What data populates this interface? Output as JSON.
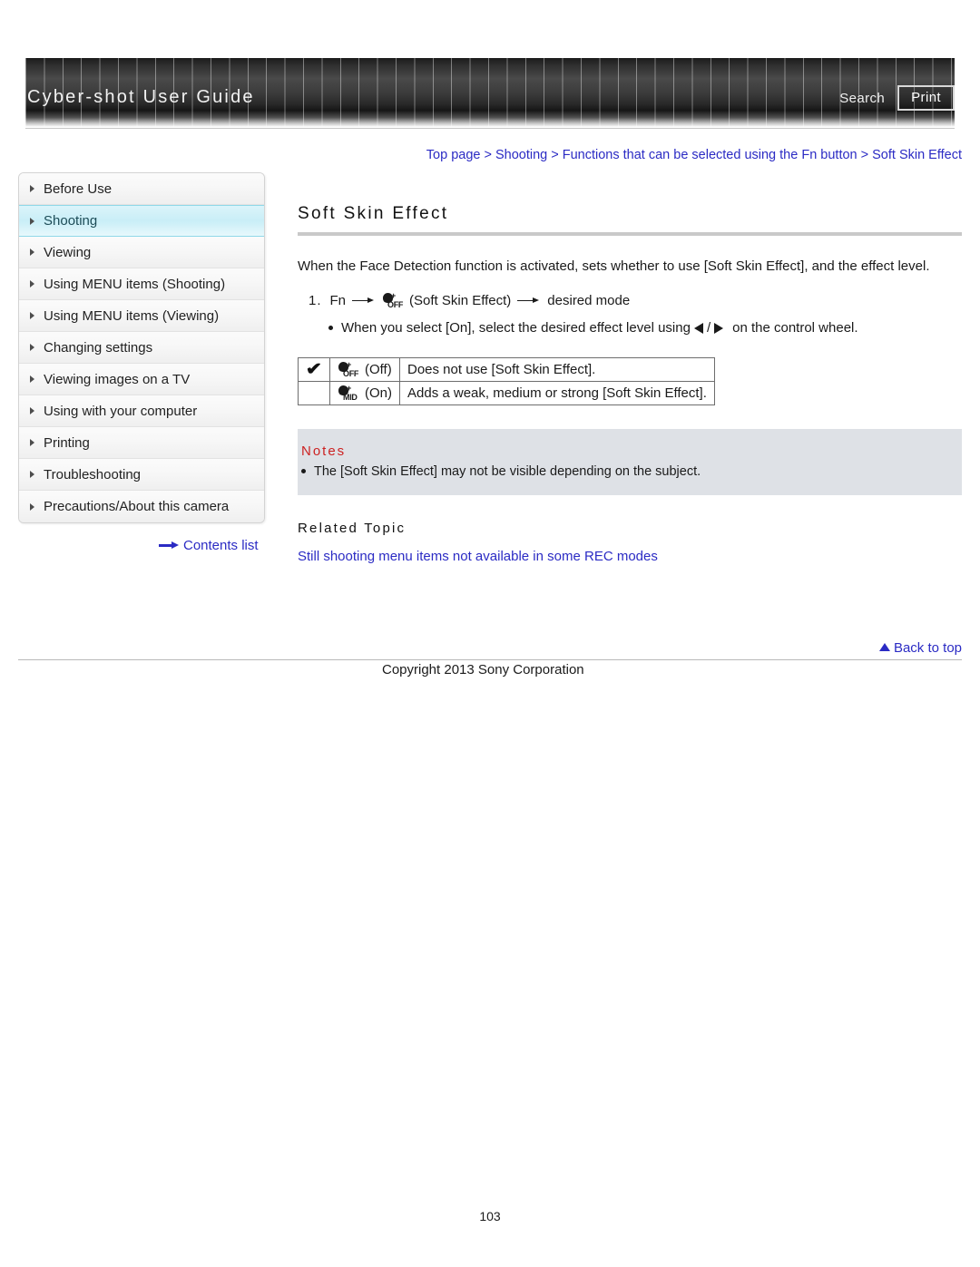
{
  "header": {
    "title": "Cyber-shot User Guide",
    "search_label": "Search",
    "print_label": "Print"
  },
  "breadcrumb": {
    "text": "Top page > Shooting > Functions that can be selected using the Fn button > Soft Skin Effect"
  },
  "sidebar": {
    "items": [
      {
        "label": "Before Use",
        "active": false
      },
      {
        "label": "Shooting",
        "active": true
      },
      {
        "label": "Viewing",
        "active": false
      },
      {
        "label": "Using MENU items (Shooting)",
        "active": false
      },
      {
        "label": "Using MENU items (Viewing)",
        "active": false
      },
      {
        "label": "Changing settings",
        "active": false
      },
      {
        "label": "Viewing images on a TV",
        "active": false
      },
      {
        "label": "Using with your computer",
        "active": false
      },
      {
        "label": "Printing",
        "active": false
      },
      {
        "label": "Troubleshooting",
        "active": false
      },
      {
        "label": "Precautions/About this camera",
        "active": false
      }
    ],
    "contents_list_label": "Contents list"
  },
  "main": {
    "title": "Soft Skin Effect",
    "intro": "When the Face Detection function is activated, sets whether to use [Soft Skin Effect], and the effect level.",
    "step_number": "1.",
    "step_fn": "Fn",
    "step_icon_label": "OFF",
    "step_icon_caption": "(Soft Skin Effect)",
    "step_tail": "desired mode",
    "bullet_before": "When you select [On], select the desired effect level using",
    "bullet_separator": "/",
    "bullet_after": "on the control wheel.",
    "table": {
      "rows": [
        {
          "checked": "✔",
          "icon_label": "OFF",
          "mode_label": "(Off)",
          "description": "Does not use [Soft Skin Effect]."
        },
        {
          "checked": "",
          "icon_label": "MID",
          "mode_label": "(On)",
          "description": "Adds a weak, medium or strong [Soft Skin Effect]."
        }
      ]
    },
    "notes_title": "Notes",
    "notes_items": [
      "The [Soft Skin Effect] may not be visible depending on the subject."
    ],
    "related_title": "Related Topic",
    "related_link": "Still shooting menu items not available in some REC modes"
  },
  "footer": {
    "back_to_top": "Back to top",
    "copyright": "Copyright 2013 Sony Corporation",
    "page_number": "103"
  },
  "colors": {
    "link": "#2b2bc4",
    "notes_title": "#cc2222",
    "notes_bg": "#dee1e6",
    "active_sidebar": "#c9eef7"
  }
}
